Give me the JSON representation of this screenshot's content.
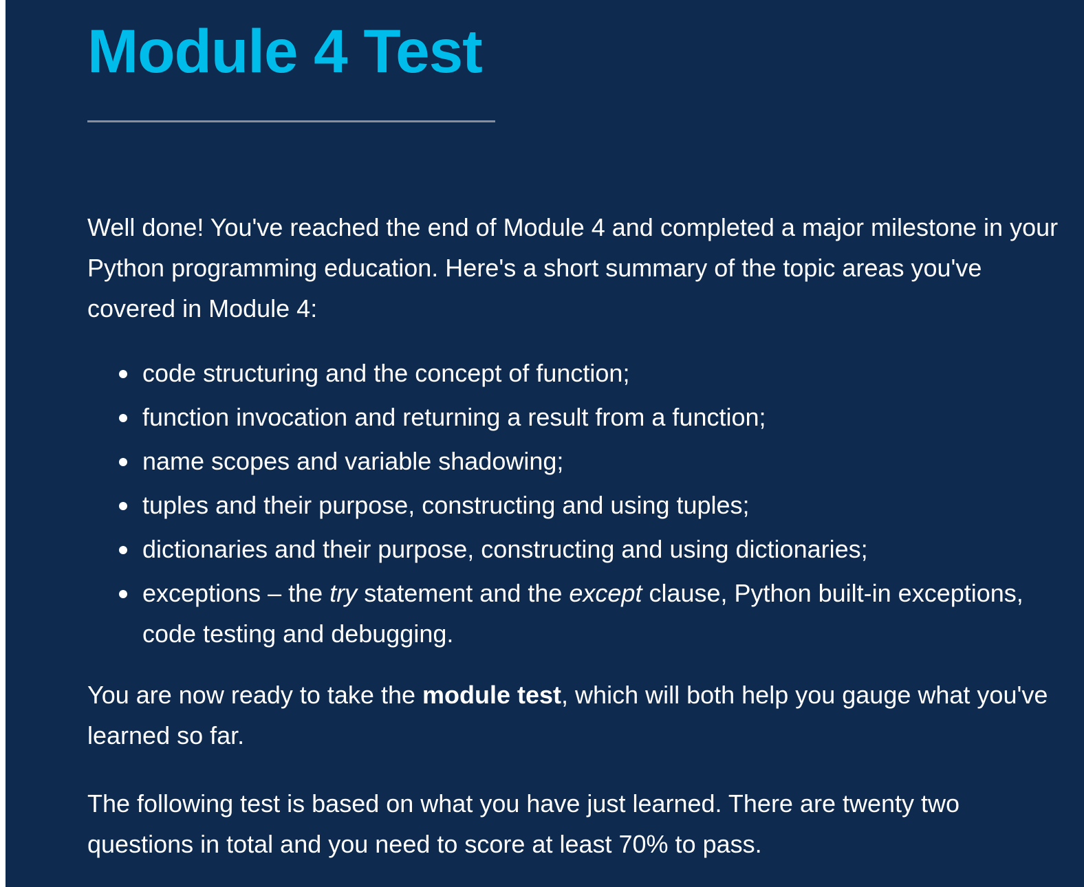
{
  "page": {
    "title": "Module 4 Test",
    "intro": "Well done! You've reached the end of Module 4 and completed a major milestone in your Python programming education. Here's a short summary of the topic areas you've covered in Module 4:",
    "topics": [
      "code structuring and the concept of function;",
      "function invocation and returning a result from a function;",
      "name scopes and variable shadowing;",
      "tuples and their purpose, constructing and using tuples;",
      "dictionaries and their purpose, constructing and using dictionaries;"
    ],
    "last_topic": {
      "part1": "exceptions – the ",
      "try": "try",
      "part2": " statement and the ",
      "except": "except",
      "part3": " clause, Python built-in exceptions, code testing and debugging."
    },
    "ready": {
      "before": "You are now ready to take the ",
      "bold": "module test",
      "after": ", which will both help you gauge what you've learned so far."
    },
    "following": "The following test is based on what you have just learned. There are twenty two questions in total and you need to score at least 70% to pass."
  },
  "colors": {
    "background": "#0e2a4e",
    "title": "#00bceb",
    "text": "#ffffff",
    "rule": "#8a8f96"
  }
}
